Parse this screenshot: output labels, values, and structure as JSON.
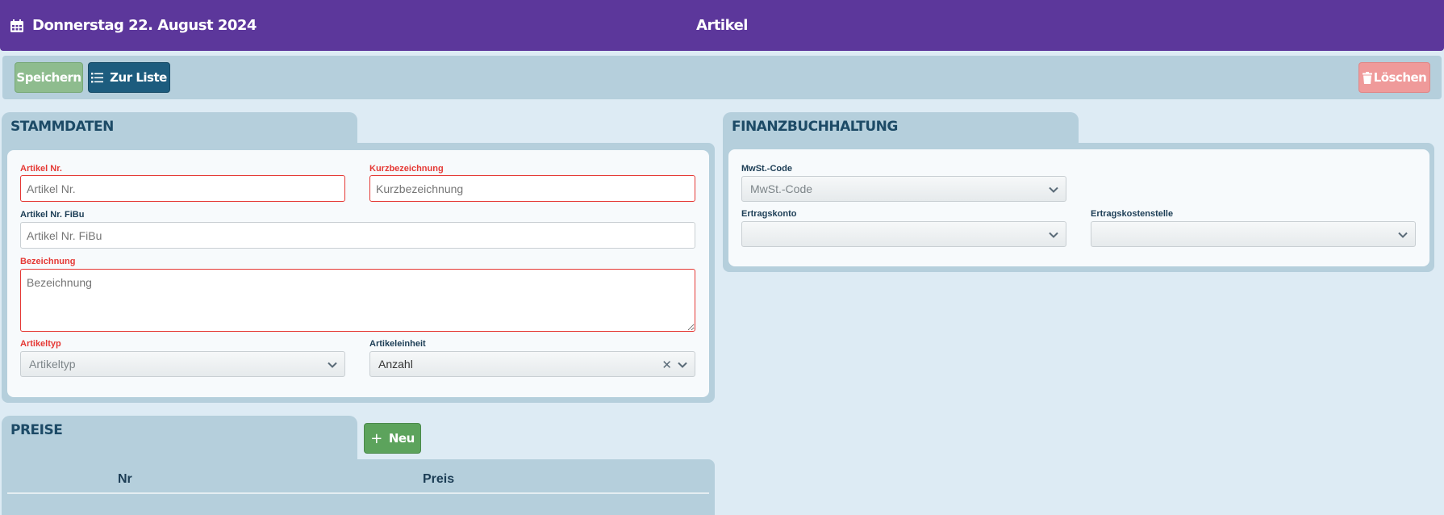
{
  "header": {
    "date": "Donnerstag 22. August 2024",
    "title": "Artikel",
    "calendar_icon": "calendar-icon"
  },
  "toolbar": {
    "save_label": "Speichern",
    "list_label": "Zur Liste",
    "delete_label": "Löschen"
  },
  "stammdaten": {
    "title": "STAMMDATEN",
    "artikel_nr": {
      "label": "Artikel Nr.",
      "placeholder": "Artikel Nr."
    },
    "kurzbezeichnung": {
      "label": "Kurzbezeichnung",
      "placeholder": "Kurzbezeichnung"
    },
    "artikel_nr_fibu": {
      "label": "Artikel Nr. FiBu",
      "placeholder": "Artikel Nr. FiBu"
    },
    "bezeichnung": {
      "label": "Bezeichnung",
      "placeholder": "Bezeichnung"
    },
    "artikeltyp": {
      "label": "Artikeltyp",
      "placeholder": "Artikeltyp"
    },
    "artikeleinheit": {
      "label": "Artikeleinheit",
      "value": "Anzahl"
    }
  },
  "fibu": {
    "title": "FINANZBUCHHALTUNG",
    "mwst_code": {
      "label": "MwSt.-Code",
      "placeholder": "MwSt.-Code"
    },
    "ertragskonto": {
      "label": "Ertragskonto",
      "value": ""
    },
    "ertragskostenstelle": {
      "label": "Ertragskostenstelle",
      "value": ""
    }
  },
  "preise": {
    "title": "PREISE",
    "new_label": "Neu",
    "columns": [
      "Nr",
      "Preis"
    ]
  },
  "colors": {
    "header": "#5c379b",
    "panel": "#b5cfdc",
    "background": "#ddebf4",
    "required": "#e53935",
    "save": "#8ebc8e",
    "list": "#1d5c7e",
    "delete": "#ef9a9a",
    "new": "#5ca35c"
  }
}
